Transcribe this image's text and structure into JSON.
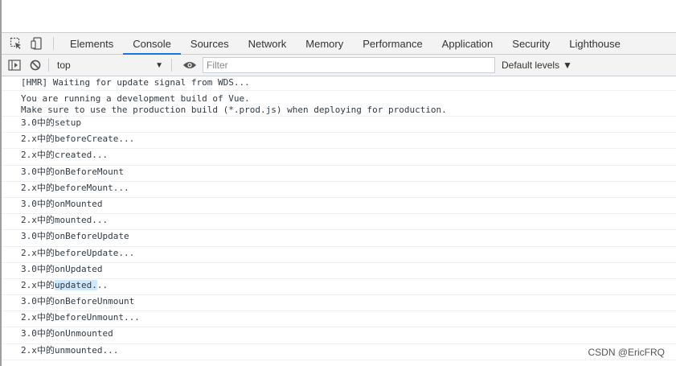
{
  "tabs": [
    "Elements",
    "Console",
    "Sources",
    "Network",
    "Memory",
    "Performance",
    "Application",
    "Security",
    "Lighthouse"
  ],
  "active_tab": "Console",
  "toolbar": {
    "context": "top",
    "filter_placeholder": "Filter",
    "levels": "Default levels"
  },
  "messages": [
    {
      "text": "[HMR] Waiting for update signal from WDS..."
    },
    {
      "line1": "You are running a development build of Vue.",
      "line2": "Make sure to use the production build (*.prod.js) when deploying for production."
    },
    {
      "text": "3.0中的setup"
    },
    {
      "text": "2.x中的beforeCreate..."
    },
    {
      "text": "2.x中的created..."
    },
    {
      "text": "3.0中的onBeforeMount"
    },
    {
      "text": "2.x中的beforeMount..."
    },
    {
      "text": "3.0中的onMounted"
    },
    {
      "text": "2.x中的mounted..."
    },
    {
      "text": "3.0中的onBeforeUpdate"
    },
    {
      "text": "2.x中的beforeUpdate..."
    },
    {
      "text": "3.0中的onUpdated"
    },
    {
      "pre": "2.x中的",
      "selected": "updated.",
      "post": ".."
    },
    {
      "text": "3.0中的onBeforeUnmount"
    },
    {
      "text": "2.x中的beforeUnmount..."
    },
    {
      "text": "3.0中的onUnmounted"
    },
    {
      "text": "2.x中的unmounted..."
    }
  ],
  "watermark": "CSDN @EricFRQ",
  "icons": [
    "inspect-element-icon",
    "device-toggle-icon",
    "sidebar-toggle-icon",
    "clear-console-icon",
    "live-expression-icon"
  ],
  "colors": {
    "accent": "#1a73e8",
    "selection": "#cfe8fc"
  }
}
